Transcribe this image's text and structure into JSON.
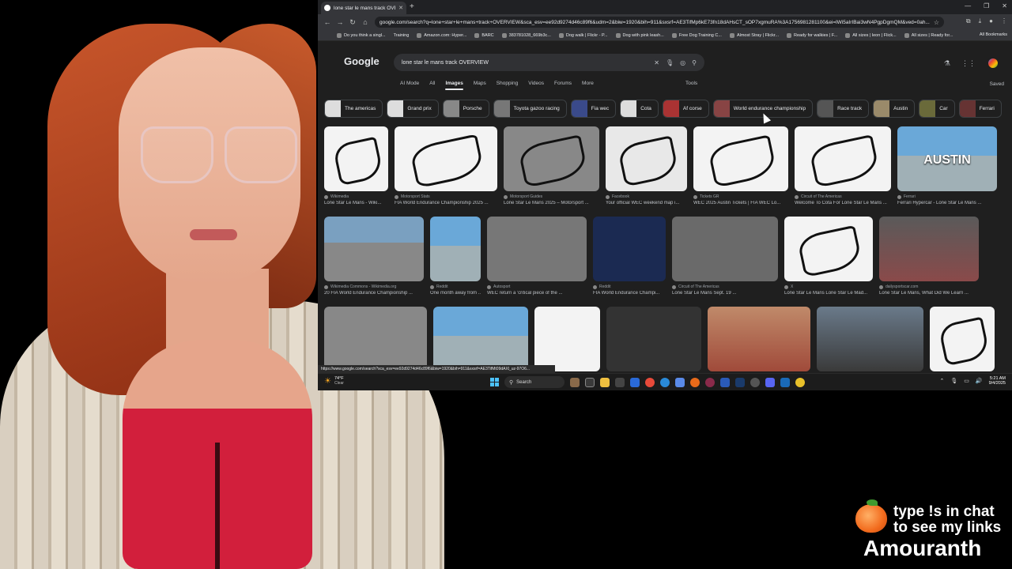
{
  "tab": {
    "title": "lone star le mans track OVERVIE"
  },
  "address": {
    "url": "google.com/search?q=lone+star+le+mans+track+OVERVIEW&sca_esv=ee92d9274d46c89f6&udm=2&biw=1920&bih=911&sxsrf=AE3TifMp6kE73fn18dAHsCT_sOP7xgmuRA%3A1756981281100&ei=lWi5aIrIBai3wN4PgpDgmQM&ved=0ah..."
  },
  "bookmarks": [
    "Do you think a singl...",
    "Training",
    "Amazon.com: Hyper...",
    "BARC",
    "383781028_669b3c...",
    "Dog walk | Flickr - P...",
    "Dog with pink leash...",
    "Free Dog Training C...",
    "Almost Stray | Flickr...",
    "Ready for walkies | F...",
    "All sizes | leon | Flick...",
    "All sizes | Ready for..."
  ],
  "bookmarks_all": "All Bookmarks",
  "google": {
    "logo": "Google",
    "query": "lone star le mans track OVERVIEW",
    "tabs": [
      "AI Mode",
      "All",
      "Images",
      "Maps",
      "Shopping",
      "Videos",
      "Forums",
      "More"
    ],
    "tools": "Tools",
    "saved": "Saved",
    "chips": [
      "The americas",
      "Grand prix",
      "Porsche",
      "Toyota gazoo racing",
      "Fia wec",
      "Cota",
      "Af corse",
      "World endurance championship",
      "Race track",
      "Austin",
      "Car",
      "Ferrari"
    ]
  },
  "results_row1": [
    {
      "src": "Wikimedia",
      "cap": "Lone Star Le Mans - Wiki..."
    },
    {
      "src": "Motorsport Stats",
      "cap": "FIA World Endurance Championship 2025 ..."
    },
    {
      "src": "Motorsport Guides",
      "cap": "Lone Star Le Mans 2025 – Motorsport ..."
    },
    {
      "src": "Facebook",
      "cap": "Your official WEC weekend map i..."
    },
    {
      "src": "Tickets GR",
      "cap": "WEC 2025 Austin Tickets | FIA WEC Lo..."
    },
    {
      "src": "Circuit of The Americas",
      "cap": "Welcome To Cota For Lone Star Le Mans ..."
    },
    {
      "src": "Ferrari",
      "cap": "Ferrari Hypercar - Lone Star Le Mans ...",
      "overlay": "AUSTIN"
    }
  ],
  "results_row2": [
    {
      "src": "Wikimedia Commons - Wikimedia.org",
      "cap": "20 FIA World Endurance Championship ..."
    },
    {
      "src": "Reddit",
      "cap": "One month away from ..."
    },
    {
      "src": "Autosport",
      "cap": "WEC return a 'critical piece of the ..."
    },
    {
      "src": "Reddit",
      "cap": "FIA World Endurance Champi..."
    },
    {
      "src": "Circuit of The Americas",
      "cap": "Lone Star Le Mans Sept. 19 ..."
    },
    {
      "src": "X",
      "cap": "Lone Star Le Mans Lone Star Le Mad..."
    },
    {
      "src": "dailysportscar.com",
      "cap": "Lone Star Le Mans, What Did We Learn ..."
    }
  ],
  "status_url": "https://www.google.com/search?sca_esv=ee92d9274d46c89f6&biw=1920&bih=911&sxsrf=AE3TifMt09dAXl_uz-97O6...",
  "taskbar": {
    "temp": "74°F",
    "condition": "Clear",
    "search": "Search",
    "time": "5:21 AM",
    "date": "9/4/2025"
  },
  "overlay": {
    "promo_line1": "type !s in chat",
    "promo_line2": "to see my links",
    "brand": "Amouranth"
  }
}
